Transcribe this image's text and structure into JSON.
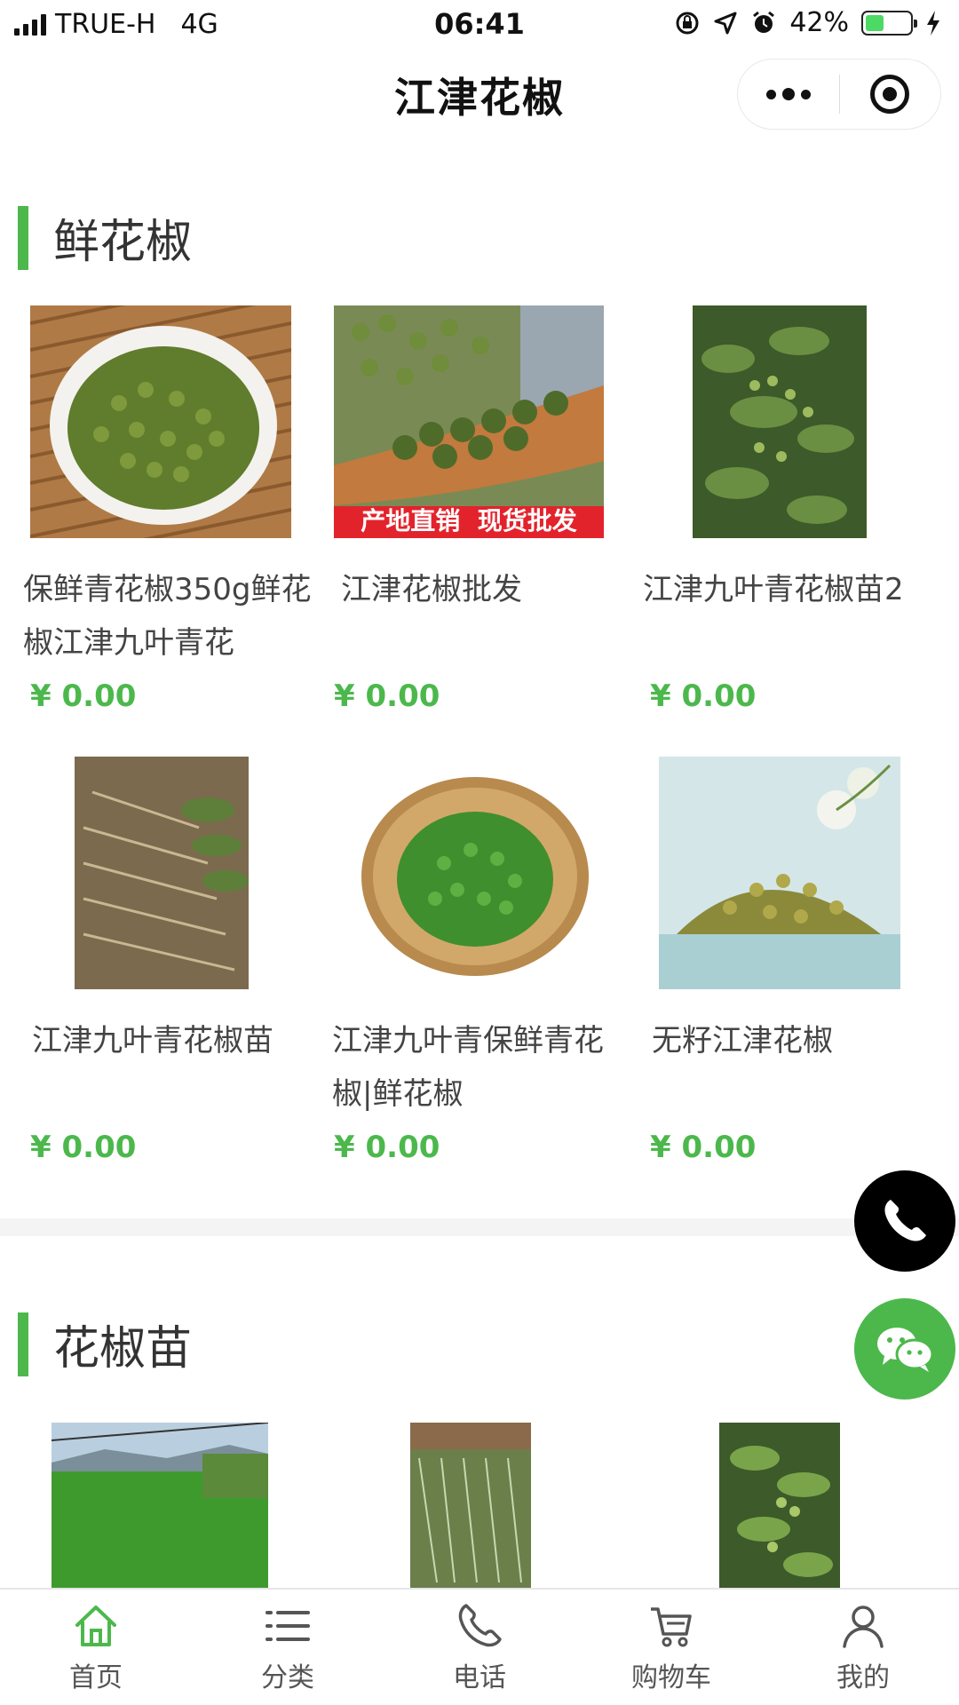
{
  "status_bar": {
    "carrier": "TRUE-H",
    "network": "4G",
    "time": "06:41",
    "battery_percent": "42%",
    "battery_level": 0.42
  },
  "header": {
    "title": "江津花椒"
  },
  "sections": [
    {
      "title": "鲜花椒",
      "products": [
        {
          "name": "保鲜青花椒350g鲜花椒江津九叶青花",
          "price": "¥ 0.00",
          "image_banner": ""
        },
        {
          "name": "江津花椒批发",
          "price": "¥ 0.00",
          "image_banner": "产地直销  现货批发"
        },
        {
          "name": "江津九叶青花椒苗2",
          "price": "¥ 0.00",
          "image_banner": ""
        },
        {
          "name": "江津九叶青花椒苗",
          "price": "¥ 0.00",
          "image_banner": ""
        },
        {
          "name": "江津九叶青保鲜青花椒|鲜花椒",
          "price": "¥ 0.00",
          "image_banner": ""
        },
        {
          "name": "无籽江津花椒",
          "price": "¥ 0.00",
          "image_banner": ""
        }
      ]
    },
    {
      "title": "花椒苗",
      "products": [
        {},
        {},
        {}
      ]
    }
  ],
  "tab_bar": {
    "items": [
      {
        "label": "首页",
        "icon": "home-icon",
        "active": true
      },
      {
        "label": "分类",
        "icon": "list-icon",
        "active": false
      },
      {
        "label": "电话",
        "icon": "phone-icon",
        "active": false
      },
      {
        "label": "购物车",
        "icon": "cart-icon",
        "active": false
      },
      {
        "label": "我的",
        "icon": "user-icon",
        "active": false
      }
    ]
  },
  "colors": {
    "accent": "#4cb84c",
    "price": "#4cb84c",
    "phone_button": "#000000",
    "wechat_button": "#4cb84c"
  }
}
